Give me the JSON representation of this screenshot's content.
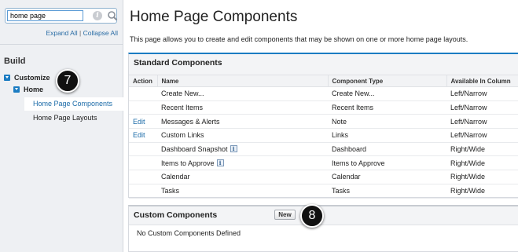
{
  "sidebar": {
    "search_value": "home page",
    "expand_all": "Expand All",
    "separator": "|",
    "collapse_all": "Collapse All",
    "section_title": "Build",
    "tree": [
      {
        "label": "Customize"
      },
      {
        "label": "Home"
      }
    ],
    "items": [
      {
        "label": "Home Page Components"
      },
      {
        "label": "Home Page Layouts"
      }
    ]
  },
  "badges": {
    "step7": "7",
    "step8": "8"
  },
  "main": {
    "title": "Home Page Components",
    "description": "This page allows you to create and edit components that may be shown on one or more home page layouts.",
    "standard": {
      "heading": "Standard Components",
      "columns": [
        "Action",
        "Name",
        "Component Type",
        "Available In Column"
      ],
      "rows": [
        {
          "action": "",
          "name": "Create New...",
          "type": "Create New...",
          "column": "Left/Narrow"
        },
        {
          "action": "",
          "name": "Recent Items",
          "type": "Recent Items",
          "column": "Left/Narrow"
        },
        {
          "action": "Edit",
          "name": "Messages & Alerts",
          "type": "Note",
          "column": "Left/Narrow"
        },
        {
          "action": "Edit",
          "name": "Custom Links",
          "type": "Links",
          "column": "Left/Narrow"
        },
        {
          "action": "",
          "name": "Dashboard Snapshot",
          "type": "Dashboard",
          "column": "Right/Wide"
        },
        {
          "action": "",
          "name": "Items to Approve",
          "type": "Items to Approve",
          "column": "Right/Wide"
        },
        {
          "action": "",
          "name": "Calendar",
          "type": "Calendar",
          "column": "Right/Wide"
        },
        {
          "action": "",
          "name": "Tasks",
          "type": "Tasks",
          "column": "Right/Wide"
        }
      ]
    },
    "custom": {
      "heading": "Custom Components",
      "new_label": "New",
      "empty_message": "No Custom Components Defined"
    }
  },
  "colors": {
    "accent": "#1b7cc2",
    "link": "#1b6ba8"
  }
}
